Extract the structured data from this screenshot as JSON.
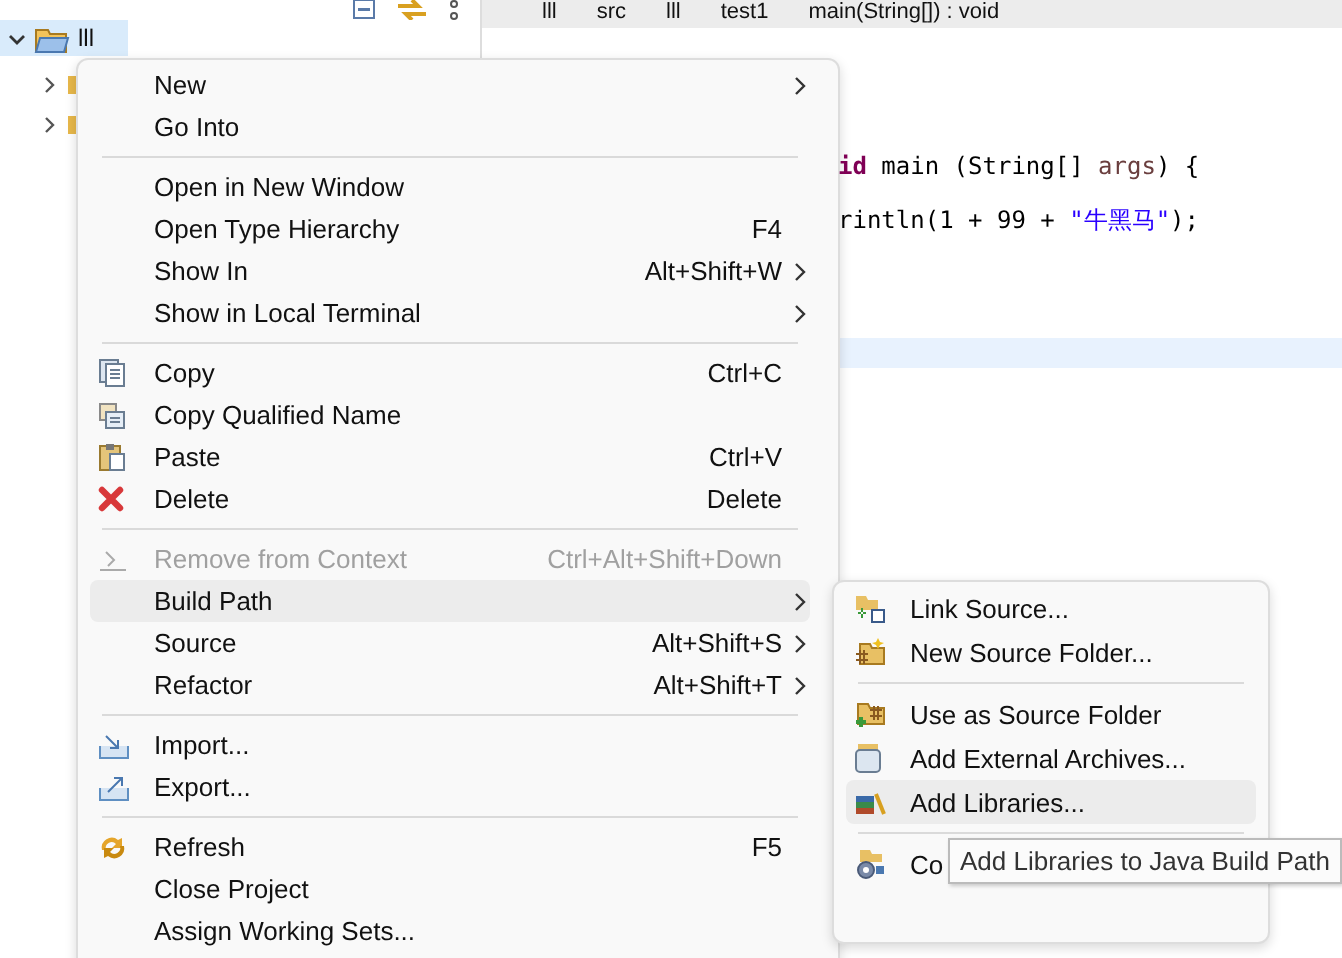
{
  "explorer": {
    "tree": [
      {
        "label": "lll",
        "expanded": true,
        "selected": true,
        "children": [
          {
            "expanded": false,
            "selected": false
          },
          {
            "expanded": false,
            "selected": false
          }
        ]
      }
    ]
  },
  "breadcrumb": [
    "lll",
    "src",
    "lll",
    "test1",
    "main(String[]) : void"
  ],
  "editor": {
    "lines": [
      [
        {
          "kind": "keyword",
          "text": "id"
        },
        {
          "kind": "plain",
          "text": " main (String[] "
        },
        {
          "kind": "param",
          "text": "args"
        },
        {
          "kind": "plain",
          "text": ") {"
        }
      ],
      [
        {
          "kind": "plain",
          "text": "rintln(1 + 99 + "
        },
        {
          "kind": "string",
          "text": "\"牛黑马\""
        },
        {
          "kind": "plain",
          "text": ");"
        }
      ]
    ]
  },
  "context_menu": {
    "items": [
      {
        "kind": "item",
        "label": "New",
        "submenu": true,
        "disabled": false,
        "selected": false
      },
      {
        "kind": "item",
        "label": "Go Into",
        "submenu": false,
        "disabled": false,
        "selected": false
      },
      {
        "kind": "separator"
      },
      {
        "kind": "item",
        "label": "Open in New Window",
        "submenu": false,
        "disabled": false,
        "selected": false
      },
      {
        "kind": "item",
        "label": "Open Type Hierarchy",
        "shortcut": "F4",
        "submenu": false,
        "disabled": false,
        "selected": false
      },
      {
        "kind": "item",
        "label": "Show In",
        "shortcut": "Alt+Shift+W",
        "submenu": true,
        "disabled": false,
        "selected": false
      },
      {
        "kind": "item",
        "label": "Show in Local Terminal",
        "submenu": true,
        "disabled": false,
        "selected": false
      },
      {
        "kind": "separator"
      },
      {
        "kind": "item",
        "label": "Copy",
        "shortcut": "Ctrl+C",
        "submenu": false,
        "disabled": false,
        "selected": false
      },
      {
        "kind": "item",
        "label": "Copy Qualified Name",
        "submenu": false,
        "disabled": false,
        "selected": false
      },
      {
        "kind": "item",
        "label": "Paste",
        "shortcut": "Ctrl+V",
        "submenu": false,
        "disabled": false,
        "selected": false
      },
      {
        "kind": "item",
        "label": "Delete",
        "shortcut": "Delete",
        "submenu": false,
        "disabled": false,
        "selected": false
      },
      {
        "kind": "separator"
      },
      {
        "kind": "item",
        "label": "Remove from Context",
        "shortcut": "Ctrl+Alt+Shift+Down",
        "submenu": false,
        "disabled": true,
        "selected": false
      },
      {
        "kind": "item",
        "label": "Build Path",
        "submenu": true,
        "disabled": false,
        "selected": true
      },
      {
        "kind": "item",
        "label": "Source",
        "shortcut": "Alt+Shift+S",
        "submenu": true,
        "disabled": false,
        "selected": false
      },
      {
        "kind": "item",
        "label": "Refactor",
        "shortcut": "Alt+Shift+T",
        "submenu": true,
        "disabled": false,
        "selected": false
      },
      {
        "kind": "separator"
      },
      {
        "kind": "item",
        "label": "Import...",
        "submenu": false,
        "disabled": false,
        "selected": false
      },
      {
        "kind": "item",
        "label": "Export...",
        "submenu": false,
        "disabled": false,
        "selected": false
      },
      {
        "kind": "separator"
      },
      {
        "kind": "item",
        "label": "Refresh",
        "shortcut": "F5",
        "submenu": false,
        "disabled": false,
        "selected": false
      },
      {
        "kind": "item",
        "label": "Close Project",
        "submenu": false,
        "disabled": false,
        "selected": false
      },
      {
        "kind": "item",
        "label": "Assign Working Sets...",
        "submenu": false,
        "disabled": false,
        "selected": false
      }
    ]
  },
  "build_path_submenu": {
    "items": [
      {
        "kind": "item",
        "label": "Link Source...",
        "selected": false
      },
      {
        "kind": "item",
        "label": "New Source Folder...",
        "selected": false
      },
      {
        "kind": "separator"
      },
      {
        "kind": "item",
        "label": "Use as Source Folder",
        "selected": false
      },
      {
        "kind": "item",
        "label": "Add External Archives...",
        "selected": false
      },
      {
        "kind": "item",
        "label": "Add Libraries...",
        "selected": true
      },
      {
        "kind": "separator"
      },
      {
        "kind": "item",
        "label": "Co",
        "selected": false
      }
    ]
  },
  "tooltip": "Add Libraries to Java Build Path"
}
